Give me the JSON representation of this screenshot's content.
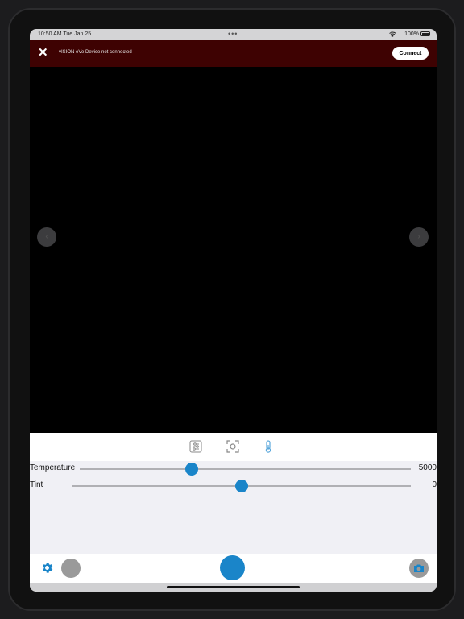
{
  "status_bar": {
    "time": "10:50 AM   Tue Jan 25",
    "dots": "•••",
    "battery": "100%"
  },
  "banner": {
    "close_symbol": "✕",
    "message": "vISION eVe Device not connected",
    "connect_label": "Connect"
  },
  "navigation": {
    "prev_symbol": "‹",
    "next_symbol": "›"
  },
  "controls": {
    "active_tab": "temperature",
    "sliders": [
      {
        "label": "Temperature",
        "value": "5000",
        "fraction": 0.337
      },
      {
        "label": "Tint",
        "value": "0",
        "fraction": 0.5
      }
    ]
  },
  "colors": {
    "accent": "#1a85c9",
    "banner_bg": "#3e0202"
  }
}
